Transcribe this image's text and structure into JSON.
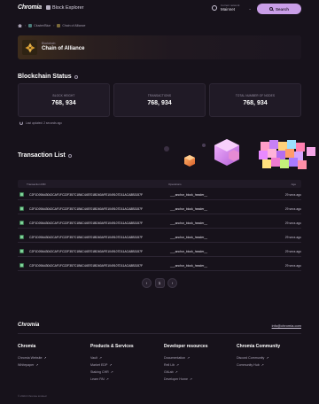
{
  "header": {
    "logo_word": "Chromia",
    "logo_sub": "Block Explorer",
    "network_label": "Current network",
    "network_value": "Mainnet",
    "search_label": "Search"
  },
  "breadcrumb": {
    "items": [
      "Cluster/Blue",
      "Chain of Alliance"
    ]
  },
  "chain": {
    "kicker": "Blockchain",
    "name": "Chain of Alliance"
  },
  "status": {
    "title": "Blockchain Status",
    "stats": [
      {
        "label": "BLOCK HEIGHT",
        "value": "768, 934"
      },
      {
        "label": "TRANSACTIONS",
        "value": "768, 934"
      },
      {
        "label": "TOTAL NUMBER OF NODES",
        "value": "768, 934"
      }
    ],
    "updated": "Last updated: 2 seconds ago"
  },
  "transactions": {
    "title": "Transaction List",
    "columns": {
      "hash": "Transaction RID",
      "operations": "Operations",
      "age": "Age"
    },
    "rows": [
      {
        "hash": "C2F1D09A43042CAF1FC22F357C1B6C445701BD60AFE1049107D11ACA8B3157F",
        "operation": "___anchor_block_header__",
        "age": "29 secs ago"
      },
      {
        "hash": "C2F1D09A43042CAF1FC22F357C1B6C445701BD60AFE1049107D11ACA8B3157F",
        "operation": "___anchor_block_header__",
        "age": "29 secs ago"
      },
      {
        "hash": "C2F1D09A43042CAF1FC22F357C1B6C445701BD60AFE1049107D11ACA8B3157F",
        "operation": "___anchor_block_header__",
        "age": "29 secs ago"
      },
      {
        "hash": "C2F1D09A43042CAF1FC22F357C1B6C445701BD60AFE1049107D11ACA8B3157F",
        "operation": "___anchor_block_header__",
        "age": "29 secs ago"
      },
      {
        "hash": "C2F1D09A43042CAF1FC22F357C1B6C445701BD60AFE1049107D11ACA8B3157F",
        "operation": "___anchor_block_header__",
        "age": "29 secs ago"
      },
      {
        "hash": "C2F1D09A43042CAF1FC22F357C1B6C445701BD60AFE1049107D11ACA8B3157F",
        "operation": "___anchor_block_header__",
        "age": "29 secs ago"
      }
    ]
  },
  "pagination": {
    "prev": "‹",
    "current": "1",
    "next": "›"
  },
  "footer": {
    "logo_word": "Chromia",
    "email": "info@chromia.com",
    "columns": [
      {
        "title": "Chromia",
        "links": [
          "Chromia Website",
          "Whitepaper"
        ]
      },
      {
        "title": "Products & Services",
        "links": [
          "Vault",
          "Market EDP",
          "Staking CHR",
          "Learn PAI"
        ]
      },
      {
        "title": "Developer resources",
        "links": [
          "Documentation",
          "Rell Lib",
          "GitLab",
          "Developer Home"
        ]
      },
      {
        "title": "Chromia Community",
        "links": [
          "Discord Community",
          "Community Hub"
        ]
      }
    ],
    "copyright": "© 2024 Chromia Limited"
  },
  "colors": {
    "background": "#17121b",
    "accent": "#c99ee8",
    "card": "#201a26",
    "success": "#3e7a52"
  }
}
